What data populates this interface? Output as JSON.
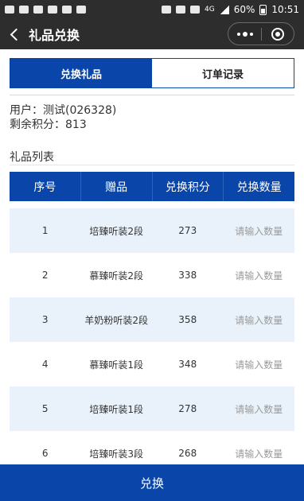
{
  "status_bar": {
    "battery_percent": "60%",
    "time": "10:51",
    "network": "4G"
  },
  "nav": {
    "title": "礼品兑换"
  },
  "tabs": [
    {
      "label": "兑换礼品",
      "active": true
    },
    {
      "label": "订单记录",
      "active": false
    }
  ],
  "user": {
    "name_line": "用户：测试(026328)",
    "points_line": "剩余积分：813"
  },
  "list_title": "礼品列表",
  "table": {
    "headers": [
      "序号",
      "赠品",
      "兑换积分",
      "兑换数量"
    ],
    "input_placeholder": "请输入数量",
    "rows": [
      {
        "index": "1",
        "gift": "培臻听装2段",
        "points": "273"
      },
      {
        "index": "2",
        "gift": "慕臻听装2段",
        "points": "338"
      },
      {
        "index": "3",
        "gift": "羊奶粉听装2段",
        "points": "358"
      },
      {
        "index": "4",
        "gift": "慕臻听装1段",
        "points": "348"
      },
      {
        "index": "5",
        "gift": "培臻听装1段",
        "points": "278"
      },
      {
        "index": "6",
        "gift": "培臻听装3段",
        "points": "268"
      }
    ]
  },
  "footer": {
    "submit_label": "兑换"
  },
  "colors": {
    "accent": "#0a46a9",
    "row_alt": "#e9f2fa",
    "header_bar": "#2d2d2d"
  }
}
